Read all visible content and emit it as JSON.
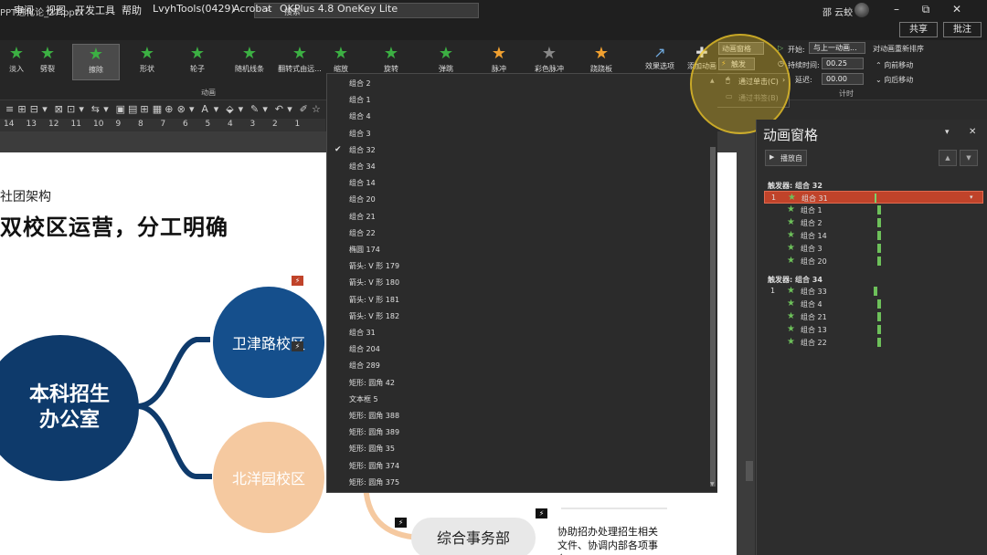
{
  "window": {
    "filename": "PPT进化论_27.pptx",
    "search_placeholder": "搜索",
    "user": "邵 云蛟",
    "share": "共享",
    "comment": "批注"
  },
  "menu": [
    "审阅",
    "视图",
    "开发工具",
    "帮助",
    "LvyhTools(0429)",
    "Acrobat",
    "OKPlus 4.8",
    "OneKey Lite"
  ],
  "ribbon": {
    "effects": [
      {
        "label": "淡入",
        "color": "#3cb043"
      },
      {
        "label": "劈裂",
        "color": "#3cb043"
      },
      {
        "label": "擦除",
        "color": "#3cb043"
      },
      {
        "label": "形状",
        "color": "#3cb043"
      },
      {
        "label": "轮子",
        "color": "#3cb043"
      },
      {
        "label": "随机线条",
        "color": "#3cb043"
      },
      {
        "label": "翻转式由远...",
        "color": "#3cb043"
      },
      {
        "label": "缩放",
        "color": "#3cb043"
      },
      {
        "label": "旋转",
        "color": "#3cb043"
      },
      {
        "label": "弹跳",
        "color": "#3cb043"
      },
      {
        "label": "脉冲",
        "color": "#f0a030"
      },
      {
        "label": "彩色脉冲",
        "color": "#888888"
      },
      {
        "label": "跷跷板",
        "color": "#f0a030"
      }
    ],
    "effect_options": "效果选项",
    "add_animation": "添加动画",
    "anim_pane_btn": "动画窗格",
    "trigger": "触发",
    "on_click": "通过单击(C)",
    "on_bookmark": "通过书签(B)",
    "start_label": "开始:",
    "start_value": "与上一动画...",
    "duration_label": "持续时间:",
    "duration_value": "00.25",
    "delay_label": "延迟:",
    "delay_value": "00.00",
    "reorder": "对动画重新排序",
    "move_earlier": "向前移动",
    "move_later": "向后移动",
    "group_animation": "动画",
    "group_timing": "计时"
  },
  "ruler": [
    "14",
    "13",
    "12",
    "11",
    "10",
    "9",
    "8",
    "7",
    "6",
    "5",
    "4",
    "3",
    "2",
    "1"
  ],
  "slide": {
    "subtitle": "社团架构",
    "title": "双校区运营，分工明确",
    "main_node": "本科招生\n办公室",
    "campus1": "卫津路校区",
    "campus2": "北洋园校区",
    "dept": "综合事务部",
    "dept_desc": "协助招办处理招生相关文件、协调内部各项事务"
  },
  "dropdown": {
    "items": [
      "组合 2",
      "组合 1",
      "组合 4",
      "组合 3",
      "组合 32",
      "组合 34",
      "组合 14",
      "组合 20",
      "组合 21",
      "组合 22",
      "椭圆 174",
      "箭头: V 形 179",
      "箭头: V 形 180",
      "箭头: V 形 181",
      "箭头: V 形 182",
      "组合 31",
      "组合 204",
      "组合 289",
      "矩形: 圆角 42",
      "文本框 5",
      "矩形: 圆角 388",
      "矩形: 圆角 389",
      "矩形: 圆角 35",
      "矩形: 圆角 374",
      "矩形: 圆角 375"
    ],
    "checked_index": 4
  },
  "pane": {
    "title": "动画窗格",
    "play_from": "播放自",
    "trigger1": "触发器: 组合 32",
    "group1": [
      {
        "num": "1",
        "name": "组合 31",
        "selected": true
      },
      {
        "num": "",
        "name": "组合 1"
      },
      {
        "num": "",
        "name": "组合 2"
      },
      {
        "num": "",
        "name": "组合 14"
      },
      {
        "num": "",
        "name": "组合 3"
      },
      {
        "num": "",
        "name": "组合 20"
      }
    ],
    "trigger2": "触发器: 组合 34",
    "group2": [
      {
        "num": "1",
        "name": "组合 33"
      },
      {
        "num": "",
        "name": "组合 4"
      },
      {
        "num": "",
        "name": "组合 21"
      },
      {
        "num": "",
        "name": "组合 13"
      },
      {
        "num": "",
        "name": "组合 22"
      }
    ]
  },
  "colors": {
    "accent": "#c0432a",
    "green": "#6dc05a",
    "navy": "#0e3a6b",
    "blue": "#154f8c",
    "peach": "#f5c9a0"
  }
}
